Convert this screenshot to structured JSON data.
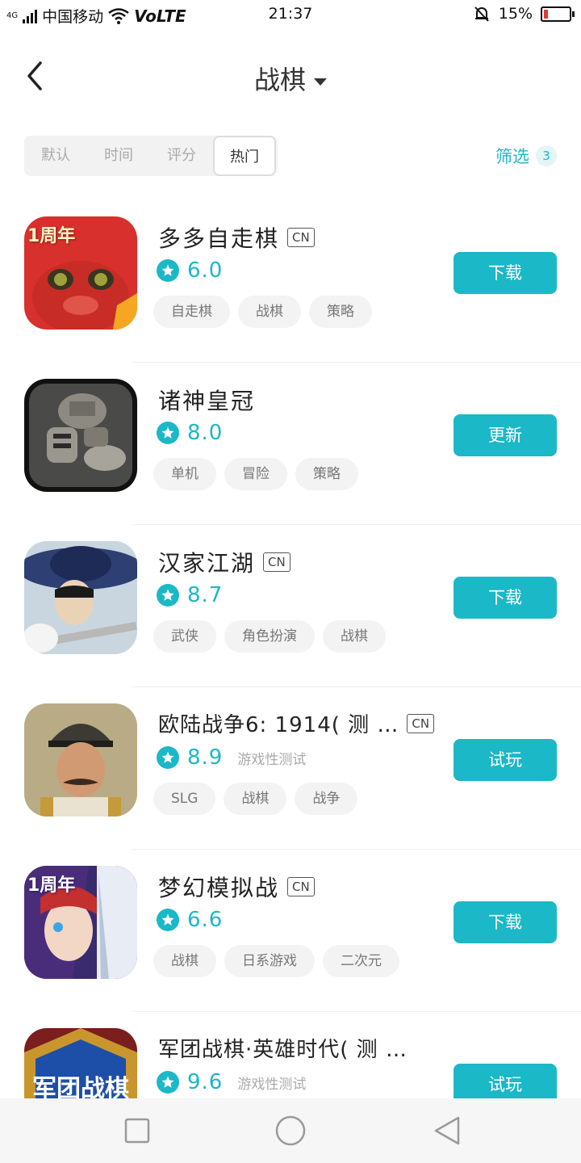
{
  "status_bar": {
    "carrier": "中国移动",
    "network": "VoLTE",
    "time": "21:37",
    "battery": "15%",
    "signal_type": "4G",
    "battery_level": 0.15
  },
  "header": {
    "title": "战棋"
  },
  "sort_tabs": [
    {
      "label": "默认"
    },
    {
      "label": "时间"
    },
    {
      "label": "评分"
    },
    {
      "label": "热门"
    }
  ],
  "filter": {
    "label": "筛选",
    "count": "3"
  },
  "colors": {
    "accent": "#1bb8c7"
  },
  "apps": [
    {
      "name": "多多自走棋",
      "cn": "CN",
      "score": "6.0",
      "test_label": "",
      "tags": [
        "自走棋",
        "战棋",
        "策略"
      ],
      "action": "下载",
      "icon_label": "1周年"
    },
    {
      "name": "诸神皇冠",
      "cn": "",
      "score": "8.0",
      "test_label": "",
      "tags": [
        "单机",
        "冒险",
        "策略"
      ],
      "action": "更新",
      "icon_label": ""
    },
    {
      "name": "汉家江湖",
      "cn": "CN",
      "score": "8.7",
      "test_label": "",
      "tags": [
        "武侠",
        "角色扮演",
        "战棋"
      ],
      "action": "下载",
      "icon_label": ""
    },
    {
      "name": "欧陆战争6: 1914( 测 …",
      "cn": "CN",
      "score": "8.9",
      "test_label": "游戏性测试",
      "tags": [
        "SLG",
        "战棋",
        "战争"
      ],
      "action": "试玩",
      "icon_label": ""
    },
    {
      "name": "梦幻模拟战",
      "cn": "CN",
      "score": "6.6",
      "test_label": "",
      "tags": [
        "战棋",
        "日系游戏",
        "二次元"
      ],
      "action": "下载",
      "icon_label": "1周年"
    },
    {
      "name": "军团战棋·英雄时代( 测 …",
      "cn": "",
      "score": "9.6",
      "test_label": "游戏性测试",
      "tags": [],
      "action": "试玩",
      "icon_label": "军团战棋"
    }
  ]
}
